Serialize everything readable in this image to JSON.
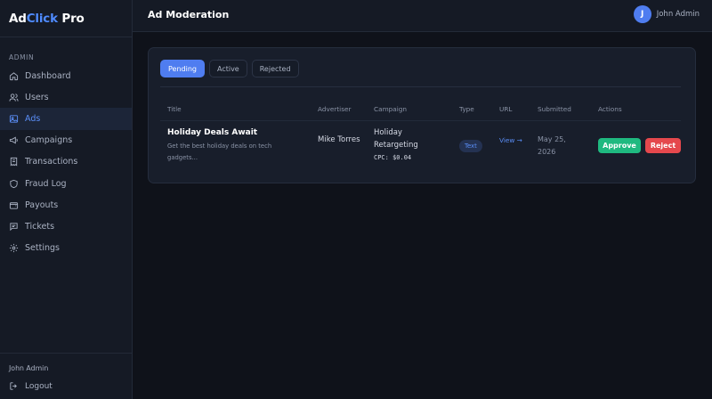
{
  "brand": {
    "part1": "Ad",
    "part2": "Click",
    "part3": " Pro"
  },
  "sidebar": {
    "section_label": "ADMIN",
    "items": [
      {
        "label": "Dashboard",
        "icon": "home-icon"
      },
      {
        "label": "Users",
        "icon": "users-icon"
      },
      {
        "label": "Ads",
        "icon": "image-icon",
        "active": true
      },
      {
        "label": "Campaigns",
        "icon": "megaphone-icon"
      },
      {
        "label": "Transactions",
        "icon": "receipt-icon"
      },
      {
        "label": "Fraud Log",
        "icon": "shield-icon"
      },
      {
        "label": "Payouts",
        "icon": "wallet-icon"
      },
      {
        "label": "Tickets",
        "icon": "message-icon"
      },
      {
        "label": "Settings",
        "icon": "gear-icon"
      }
    ],
    "user_name": "John Admin",
    "logout_label": "Logout"
  },
  "header": {
    "title": "Ad Moderation",
    "avatar_initial": "J",
    "user_name": "John Admin"
  },
  "tabs": [
    {
      "label": "Pending",
      "active": true
    },
    {
      "label": "Active"
    },
    {
      "label": "Rejected"
    }
  ],
  "table": {
    "columns": [
      "Title",
      "Advertiser",
      "Campaign",
      "Type",
      "URL",
      "Submitted",
      "Actions"
    ],
    "rows": [
      {
        "title": "Holiday Deals Await",
        "description": "Get the best holiday deals on tech gadgets...",
        "advertiser": "Mike Torres",
        "campaign": "Holiday Retargeting",
        "cpc": "CPC: $0.04",
        "type": "Text",
        "url_label": "View →",
        "submitted": "May 25, 2026",
        "approve_label": "Approve",
        "reject_label": "Reject"
      }
    ]
  },
  "colors": {
    "accent": "#4f7df0",
    "approve": "#1fb980",
    "reject": "#e5484d",
    "background": "#0f121a",
    "panel": "#151a25"
  }
}
